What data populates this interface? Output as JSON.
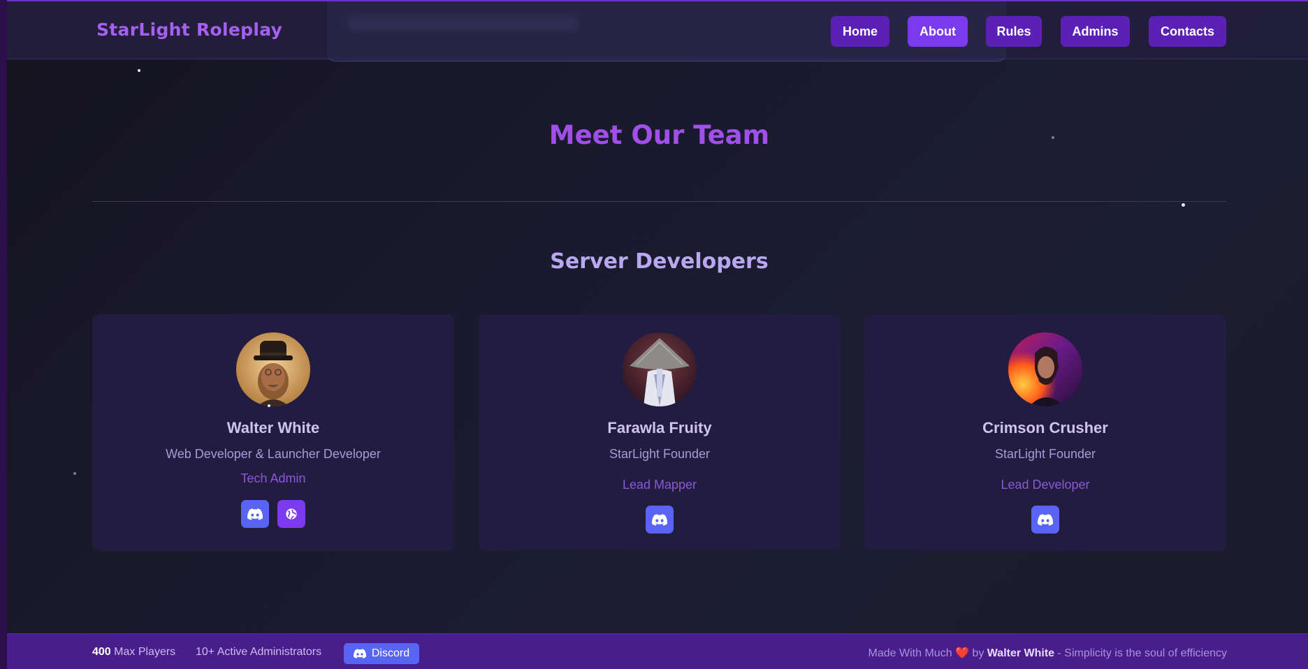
{
  "header": {
    "brand": "StarLight Roleplay",
    "nav": [
      {
        "label": "Home",
        "active": false
      },
      {
        "label": "About",
        "active": true
      },
      {
        "label": "Rules",
        "active": false
      },
      {
        "label": "Admins",
        "active": false
      },
      {
        "label": "Contacts",
        "active": false
      }
    ]
  },
  "team": {
    "title": "Meet Our Team",
    "section_title": "Server Developers",
    "members": [
      {
        "name": "Walter White",
        "role": "Web Developer & Launcher Developer",
        "tag": "Tech Admin",
        "links": [
          "discord-icon",
          "globe-icon"
        ]
      },
      {
        "name": "Farawla Fruity",
        "role": "StarLight Founder",
        "tag": "Lead Mapper",
        "links": [
          "discord-icon"
        ]
      },
      {
        "name": "Crimson Crusher",
        "role": "StarLight Founder",
        "tag": "Lead Developer",
        "links": [
          "discord-icon"
        ]
      }
    ]
  },
  "footer": {
    "max_players_value": "400",
    "max_players_label": "Max Players",
    "admins_label": "10+ Active Administrators",
    "discord_label": "Discord",
    "made_with": "Made With Much",
    "heart": "❤️",
    "by": "by",
    "author": "Walter White",
    "tagline": "- Simplicity is the soul of efficiency"
  },
  "colors": {
    "accent": "#7c3aed",
    "nav_button": "#5b21b6",
    "discord": "#5865f2",
    "footer_bg": "#4a1d8c",
    "title": "#a050e8"
  }
}
